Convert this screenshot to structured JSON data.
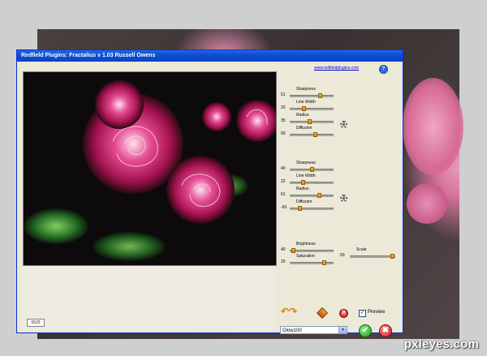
{
  "window": {
    "title": "Redfield Plugins: Fractalius v 1.03   Russell Owens",
    "website": "www.redfieldplugins.com",
    "help_symbol": "?",
    "zoom_value": "0625"
  },
  "groups": [
    {
      "rows": [
        {
          "label": "Sharpness",
          "value": "51",
          "level": 0.72
        },
        {
          "label": "Line Width",
          "value": "20",
          "level": 0.3
        },
        {
          "label": "Radius",
          "value": "35",
          "level": 0.45
        },
        {
          "label": "Diffusion",
          "value": "00",
          "level": 0.6
        }
      ]
    },
    {
      "rows": [
        {
          "label": "Sharpness",
          "value": "40",
          "level": 0.5
        },
        {
          "label": "Line Width",
          "value": "22",
          "level": 0.28
        },
        {
          "label": "Radius",
          "value": "61",
          "level": 0.7
        },
        {
          "label": "Diffusion",
          "value": "-65",
          "level": 0.2
        }
      ]
    }
  ],
  "color_controls": {
    "brightness": {
      "label": "Brightness",
      "value": "40",
      "level": 0.05
    },
    "saturation": {
      "label": "Saturation",
      "value": "25",
      "level": 0.82
    },
    "scale": {
      "label": "Scale",
      "value": "50",
      "level": 0.98
    }
  },
  "bottom": {
    "preview_label": "Preview",
    "preview_checked": true,
    "check_mark": "✓",
    "preset_value": "Glow100",
    "dropdown_arrow": "▼",
    "ok_symbol": "✔",
    "cancel_symbol": "✖",
    "reset_symbol": "R",
    "undo_redo_symbol": "↶↷"
  },
  "watermark": "pxleyes.com",
  "icons": [
    "gear-icon",
    "undo-icon",
    "redo-icon",
    "randomize-icon",
    "reset-icon",
    "ok-icon",
    "cancel-icon",
    "help-icon"
  ],
  "colors": {
    "title_bar": "#0b4fd2",
    "panel": "#ece9d8",
    "slider_thumb": "#f0a52a"
  }
}
